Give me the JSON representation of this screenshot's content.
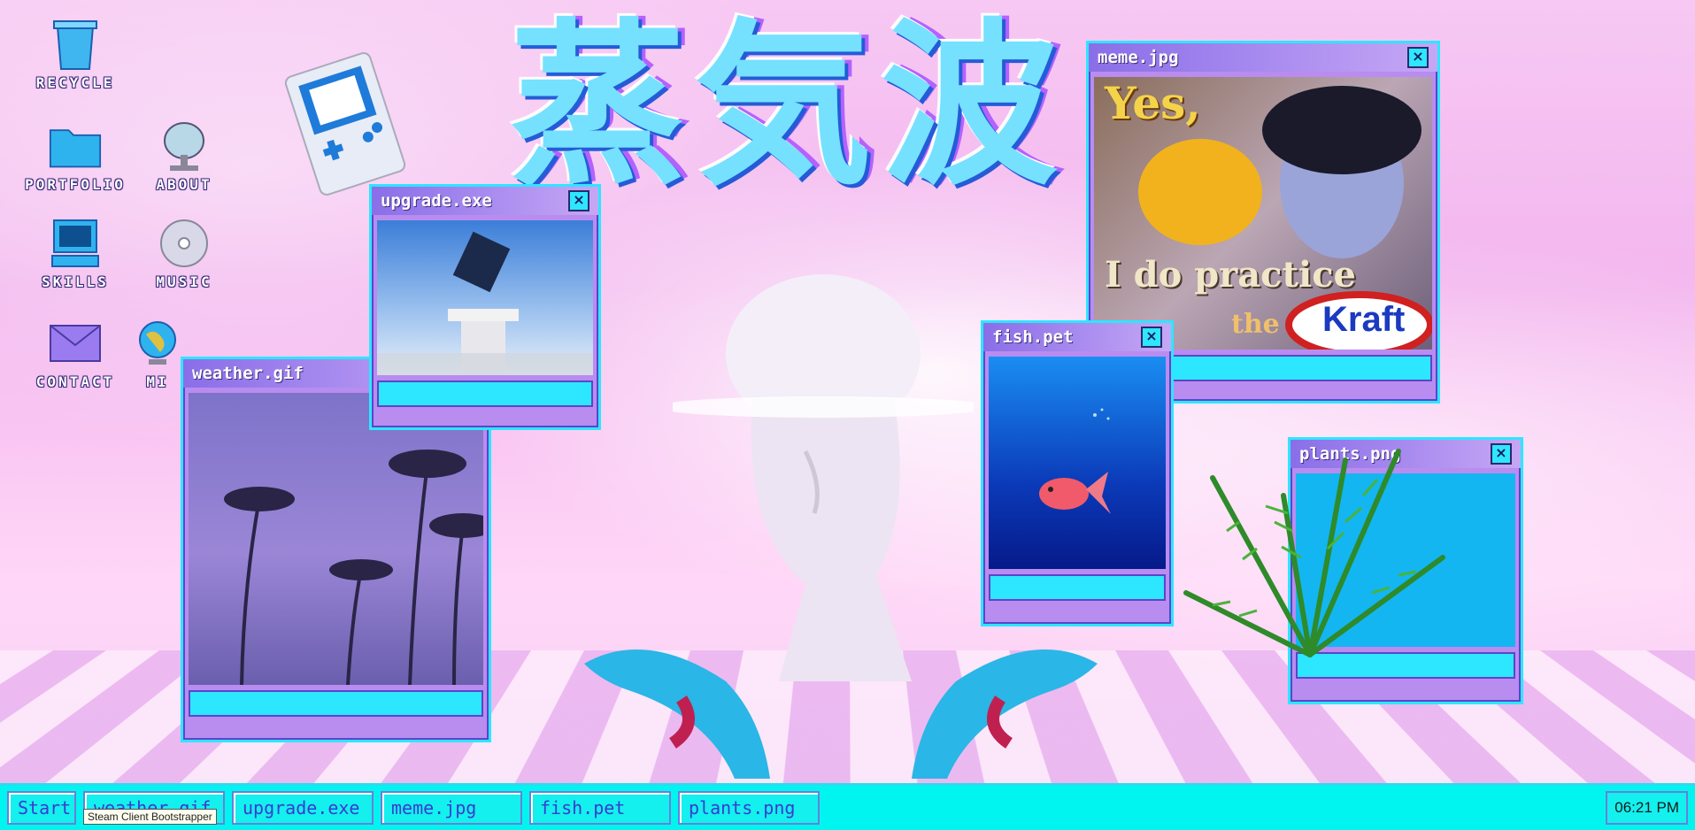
{
  "desktop": {
    "title_art": "蒸気波",
    "icons": [
      {
        "label": "RECYCLE",
        "icon": "recycle-bin-icon"
      },
      {
        "label": "PORTFOLIO",
        "icon": "folder-icon"
      },
      {
        "label": "ABOUT",
        "icon": "satellite-dish-icon"
      },
      {
        "label": "SKILLS",
        "icon": "computer-icon"
      },
      {
        "label": "MUSIC",
        "icon": "cd-icon"
      },
      {
        "label": "CONTACT",
        "icon": "envelope-icon"
      },
      {
        "label": "MI",
        "icon": "globe-icon"
      }
    ]
  },
  "windows": {
    "meme": {
      "title": "meme.jpg",
      "close": "×",
      "meme_text": [
        "Yes,",
        "I do practice",
        "the",
        "Kraft"
      ]
    },
    "upgrade": {
      "title": "upgrade.exe",
      "close": "×"
    },
    "weather": {
      "title": "weather.gif",
      "close": "×"
    },
    "fish": {
      "title": "fish.pet",
      "close": "×"
    },
    "plants": {
      "title": "plants.png",
      "close": "×"
    }
  },
  "taskbar": {
    "start": "Start",
    "items": [
      "weather.gif",
      "upgrade.exe",
      "meme.jpg",
      "fish.pet",
      "plants.png"
    ],
    "clock": "06:21 PM",
    "tooltip": "Steam Client Bootstrapper"
  },
  "colors": {
    "accent": "#2de6ff",
    "window": "#b98cf0",
    "taskbar": "#00f5f0"
  }
}
